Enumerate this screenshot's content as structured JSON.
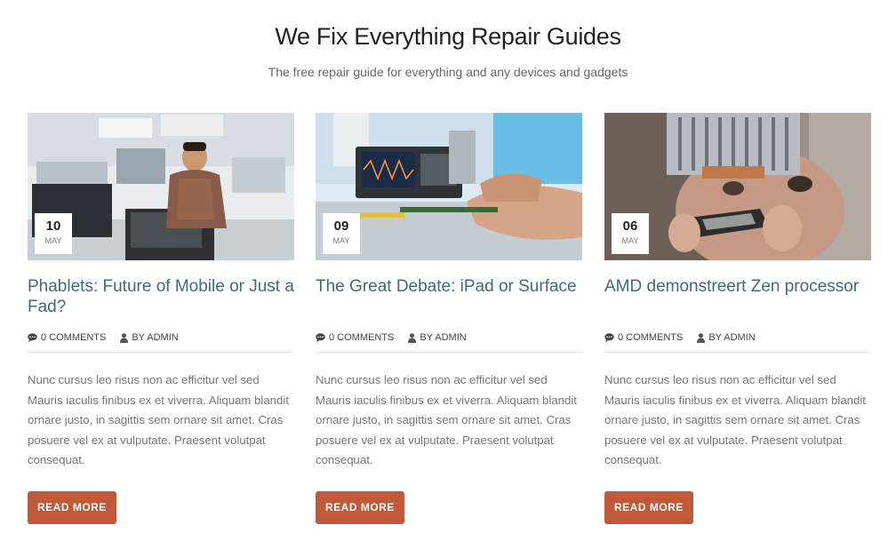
{
  "section": {
    "title": "We Fix Everything Repair Guides",
    "subtitle": "The free repair guide for everything and any devices and gadgets"
  },
  "posts": [
    {
      "day": "10",
      "month": "May",
      "title": "Phablets: Future of Mobile or Just a Fad?",
      "comments": "0 Comments",
      "author": "By Admin",
      "excerpt": "Nunc cursus leo risus non ac efficitur vel sed Mauris iaculis finibus ex et viverra. Aliquam blandit ornare justo, in sagittis sem ornare sit amet. Cras posuere vel ex at vulputate. Praesent volutpat consequat.",
      "read_more": "Read More"
    },
    {
      "day": "09",
      "month": "May",
      "title": "The Great Debate: iPad or Surface",
      "comments": "0 Comments",
      "author": "By Admin",
      "excerpt": "Nunc cursus leo risus non ac efficitur vel sed Mauris iaculis finibus ex et viverra. Aliquam blandit ornare justo, in sagittis sem ornare sit amet. Cras posuere vel ex at vulputate. Praesent volutpat consequat.",
      "read_more": "Read More"
    },
    {
      "day": "06",
      "month": "May",
      "title": "AMD demonstreert Zen processor",
      "comments": "0 Comments",
      "author": "By Admin",
      "excerpt": "Nunc cursus leo risus non ac efficitur vel sed Mauris iaculis finibus ex et viverra. Aliquam blandit ornare justo, in sagittis sem ornare sit amet. Cras posuere vel ex at vulputate. Praesent volutpat consequat.",
      "read_more": "Read More"
    }
  ],
  "icons": {
    "comments": "comment-icon",
    "author": "user-icon"
  },
  "colors": {
    "title_link": "#3f6a7a",
    "button": "#c0583a"
  }
}
